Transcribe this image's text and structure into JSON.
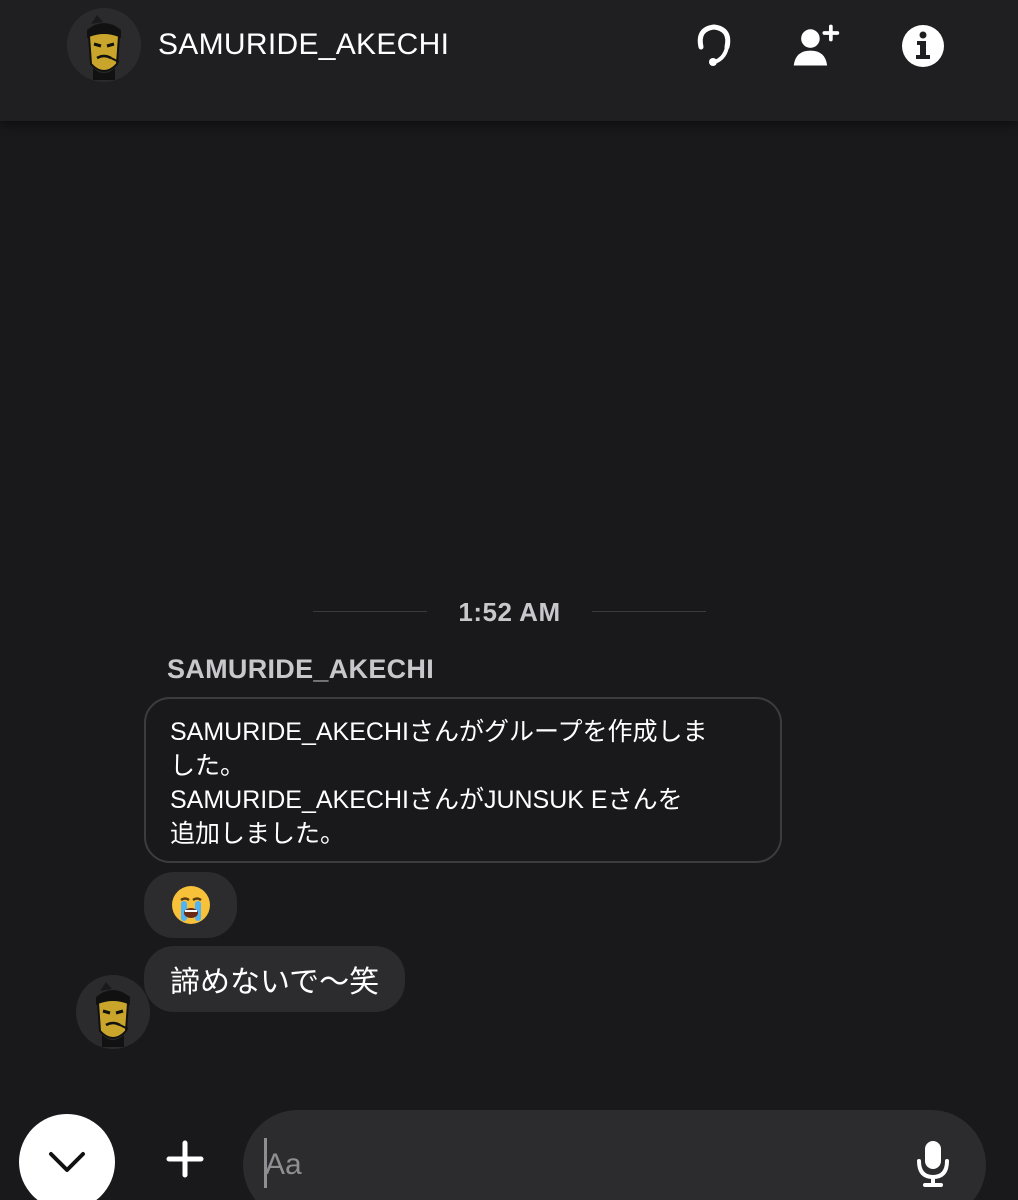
{
  "header": {
    "title": "SAMURIDE_AKECHI",
    "avatar_icon": "samurai-avatar-icon",
    "icons": [
      "headset-call-icon",
      "add-user-icon",
      "info-icon"
    ]
  },
  "chat": {
    "timestamp": "1:52 AM",
    "sender_name": "SAMURIDE_AKECHI",
    "system_message": {
      "line1": "SAMURIDE_AKECHIさんがグループを作成しま",
      "line2": "した。",
      "line3": "SAMURIDE_AKECHIさんがJUNSUK Eさんを",
      "line4": "追加しました。"
    },
    "emoji_message": "😭",
    "text_message": "諦めないで〜笑"
  },
  "composer": {
    "placeholder": "Aa",
    "value": "",
    "icons": [
      "chevron-down-icon",
      "plus-icon",
      "microphone-icon"
    ]
  },
  "colors": {
    "background": "#19191b",
    "header": "#1f1f21",
    "bubble": "#2c2c2e",
    "border": "#3c3c3f",
    "muted_text": "#c7c7cc",
    "avatar_gold": "#c9a62b"
  }
}
